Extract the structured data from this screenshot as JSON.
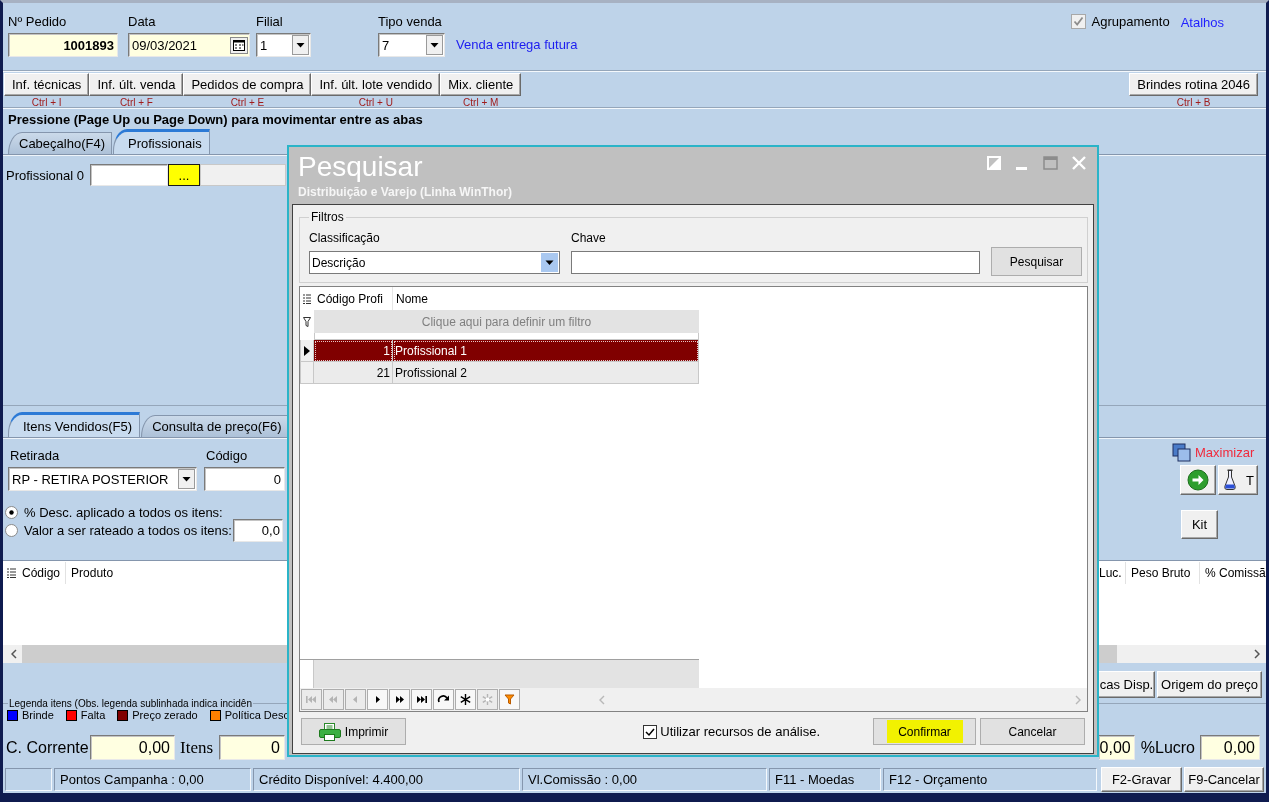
{
  "header": {
    "order_number": {
      "label": "Nº Pedido",
      "value": "1001893"
    },
    "date": {
      "label": "Data",
      "value": "09/03/2021"
    },
    "branch": {
      "label": "Filial",
      "value": "1"
    },
    "sale_type": {
      "label": "Tipo venda",
      "value": "7",
      "description": "Venda entrega futura"
    },
    "grouping": {
      "label": "Agrupamento",
      "checked": true,
      "disabled": true
    },
    "shortcuts_link": "Atalhos"
  },
  "toolbar": {
    "buttons": [
      {
        "label": "Inf. técnicas",
        "shortcut": "Ctrl + I"
      },
      {
        "label": "Inf. últ. venda",
        "shortcut": "Ctrl + F"
      },
      {
        "label": "Pedidos de compra",
        "shortcut": "Ctrl + E"
      },
      {
        "label": "Inf. últ. lote vendido",
        "shortcut": "Ctrl + U"
      },
      {
        "label": "Mix. cliente",
        "shortcut": "Ctrl + M"
      }
    ],
    "gifts_button": {
      "label": "Brindes rotina 2046",
      "shortcut": "Ctrl + B"
    }
  },
  "hint": "Pressione (Page Up ou Page Down) para movimentar entre as abas",
  "header_tabs": [
    {
      "label": "Cabeçalho(F4)",
      "selected": false
    },
    {
      "label": "Profissionais",
      "selected": true
    }
  ],
  "professional": {
    "label": "Profissional 0",
    "lookup_button": {
      "label": "...",
      "highlighted": true
    }
  },
  "items": {
    "tabs": [
      {
        "label": "Itens Vendidos(F5)",
        "selected": true
      },
      {
        "label": "Consulta de preço(F6)",
        "selected": false
      }
    ],
    "withdrawal": {
      "label": "Retirada",
      "value": "RP - RETIRA POSTERIOR"
    },
    "code": {
      "label": "Código",
      "value": "0"
    },
    "discount_options": [
      {
        "label": "% Desc. aplicado a todos os itens:",
        "selected": true
      },
      {
        "label": "Valor a ser rateado a todos os itens:",
        "selected": false,
        "value": "0,0"
      }
    ],
    "maximize_link": "Maximizar",
    "tool_buttons": [
      {
        "kind": "go"
      },
      {
        "kind": "flask",
        "label": "T"
      }
    ],
    "kit_button": {
      "label": "Kit"
    },
    "table": {
      "columns_left": [
        "Código",
        "Produto"
      ],
      "columns_right": [
        "Luc.",
        "Peso Bruto",
        "% Comissã"
      ]
    },
    "table_buttons": [
      {
        "label": "cas Disp."
      },
      {
        "label": "Origem do preço"
      }
    ],
    "legend": {
      "title": "Legenda itens (Obs. legenda sublinhada indica incidên",
      "items": [
        {
          "label": "Brinde",
          "color": "#0000ff"
        },
        {
          "label": "Falta",
          "color": "#ff0000"
        },
        {
          "label": "Preço zerado",
          "color": "#800000"
        },
        {
          "label": "Política Desc",
          "color": "#ff8000"
        }
      ]
    },
    "totals_left": [
      {
        "label": "C. Corrente",
        "value": "0,00"
      },
      {
        "label": "Itens",
        "value": "0"
      }
    ],
    "totals_right": [
      {
        "value": "0,00"
      },
      {
        "label": "%Lucro",
        "value": "0,00"
      }
    ]
  },
  "status_bar": {
    "panels": [
      "Pontos Campanha : 0,00",
      "Crédito Disponível: 4.400,00",
      "Vl.Comissão : 0,00",
      "F11 - Moedas",
      "F12 - Orçamento"
    ],
    "buttons": [
      "F2-Gravar",
      "F9-Cancelar"
    ]
  },
  "search_dialog": {
    "title": "Pesquisar",
    "subtitle": "Distribuição e Varejo (Linha WinThor)",
    "filters": {
      "title": "Filtros",
      "classification": {
        "label": "Classificação",
        "value": "Descrição"
      },
      "key": {
        "label": "Chave"
      },
      "search_button": {
        "label": "Pesquisar"
      }
    },
    "grid": {
      "columns": [
        "Código Profi",
        "Nome"
      ],
      "filter_hint": "Clique aqui para definir um filtro",
      "rows": [
        {
          "code": "1",
          "name": "Profissional 1",
          "selected": true
        },
        {
          "code": "21",
          "name": "Profissional 2",
          "selected": false
        }
      ]
    },
    "navigator": [
      {
        "kind": "first",
        "disabled": true
      },
      {
        "kind": "prior_page",
        "disabled": true
      },
      {
        "kind": "prior",
        "disabled": true
      },
      {
        "kind": "next",
        "disabled": false
      },
      {
        "kind": "next_page",
        "disabled": false
      },
      {
        "kind": "last",
        "disabled": false
      },
      {
        "kind": "refresh",
        "disabled": false
      },
      {
        "kind": "insert",
        "disabled": false
      },
      {
        "kind": "cancel",
        "disabled": true
      },
      {
        "kind": "filter",
        "disabled": false
      }
    ],
    "print_button": {
      "label": "Imprimir"
    },
    "analysis": {
      "label": "Utilizar recursos de análise.",
      "checked": true
    },
    "buttons": [
      {
        "label": "Confirmar",
        "highlighted": true
      },
      {
        "label": "Cancelar",
        "highlighted": false
      }
    ]
  }
}
